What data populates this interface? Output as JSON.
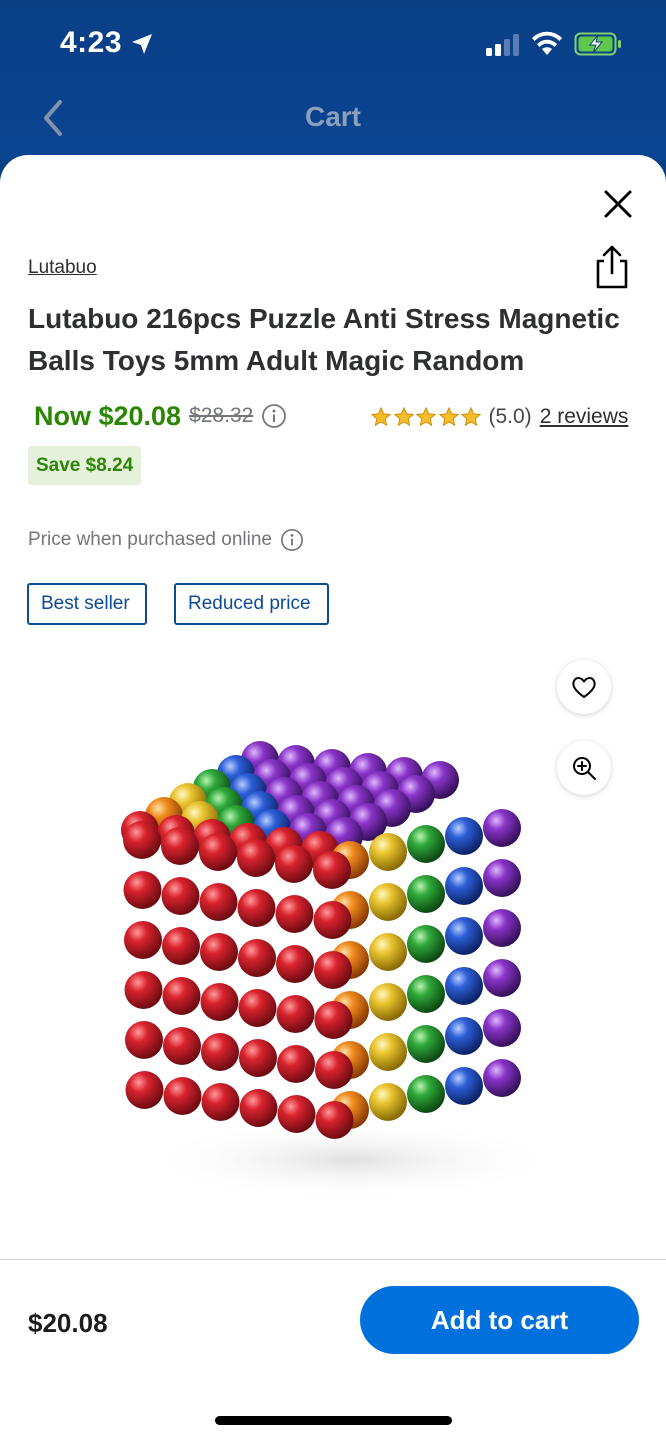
{
  "status_bar": {
    "time": "4:23",
    "icons": [
      "location-arrow-icon",
      "cellular-signal-icon",
      "wifi-icon",
      "battery-charging-icon"
    ]
  },
  "header": {
    "title": "Cart",
    "back_icon": "chevron-left-icon",
    "background_color": "#0a3f86"
  },
  "product": {
    "brand": "Lutabuo",
    "title": "Lutabuo 216pcs Puzzle Anti Stress Magnetic Balls Toys 5mm Adult Magic Random",
    "now_price": "Now $20.08",
    "was_price": "$28.32",
    "rating_stars": 5,
    "rating_text": "(5.0)",
    "reviews_link": "2 reviews",
    "save_badge": "Save $8.24",
    "price_note": "Price when purchased online",
    "tags": [
      "Best seller",
      "Reduced price"
    ],
    "image_icon": "magnetic-balls-cube-image"
  },
  "footer": {
    "price": "$20.08",
    "add_to_cart_label": "Add to cart"
  },
  "colors": {
    "accent_green": "#2a8703",
    "primary_blue": "#0071dc",
    "tag_blue": "#0d4b98",
    "star_gold": "#f6bd2b"
  }
}
